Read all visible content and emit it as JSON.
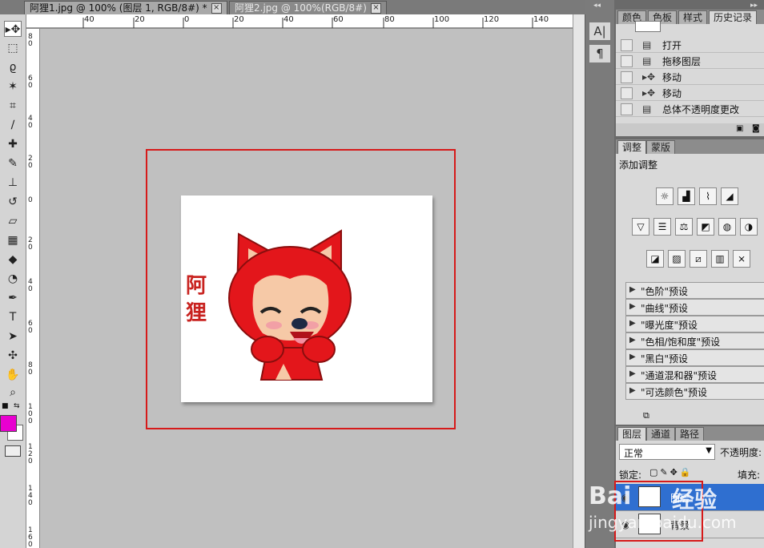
{
  "tabs": [
    {
      "label": "阿狸1.jpg @ 100% (图层 1, RGB/8#) *",
      "close": "×"
    },
    {
      "label": "阿狸2.jpg @ 100%(RGB/8#)",
      "close": "×"
    }
  ],
  "ruler": {
    "h_labels": [
      "40",
      "20",
      "0",
      "20",
      "40",
      "60",
      "80",
      "100",
      "120",
      "140"
    ],
    "v_labels": [
      "80",
      "60",
      "40",
      "20",
      "0",
      "20",
      "40",
      "60",
      "80",
      "100",
      "120",
      "140",
      "160"
    ]
  },
  "toolbar": {
    "icons": [
      "move-icon",
      "marquee-icon",
      "lasso-icon",
      "magic-wand-icon",
      "crop-icon",
      "eyedropper-icon",
      "healing-brush-icon",
      "brush-icon",
      "clone-stamp-icon",
      "history-brush-icon",
      "eraser-icon",
      "gradient-icon",
      "blur-icon",
      "dodge-icon",
      "pen-icon",
      "type-icon",
      "path-select-icon",
      "shape-icon",
      "hand-icon",
      "zoom-icon"
    ],
    "foreground_color": "#e800d0",
    "background_color": "#ffffff"
  },
  "canvas": {
    "text": "阿狸"
  },
  "mid_dock": {
    "btn1": "A|",
    "btn2": "¶"
  },
  "history_panel": {
    "tabs": [
      "颜色",
      "色板",
      "样式",
      "历史记录"
    ],
    "active_tab": "历史记录",
    "items": [
      {
        "icon": "document-icon",
        "label": "打开"
      },
      {
        "icon": "document-icon",
        "label": "拖移图层"
      },
      {
        "icon": "move-icon",
        "label": "移动"
      },
      {
        "icon": "move-icon",
        "label": "移动"
      },
      {
        "icon": "document-icon",
        "label": "总体不透明度更改"
      }
    ]
  },
  "adjust_panel": {
    "tabs": [
      "调整",
      "蒙版"
    ],
    "active_tab": "调整",
    "title": "添加调整",
    "presets": [
      "\"色阶\"预设",
      "\"曲线\"预设",
      "\"曝光度\"预设",
      "\"色相/饱和度\"预设",
      "\"黑白\"预设",
      "\"通道混和器\"预设",
      "\"可选颜色\"预设"
    ]
  },
  "layers_panel": {
    "tabs": [
      "图层",
      "通道",
      "路径"
    ],
    "active_tab": "图层",
    "blend_mode": "正常",
    "opacity_label": "不透明度:",
    "lock_label": "锁定:",
    "fill_label": "填充:",
    "layers": [
      {
        "name": "图层",
        "selected": true
      },
      {
        "name": "背景",
        "selected": false
      }
    ]
  },
  "watermark": {
    "brand": "Bai",
    "brand2": "经验",
    "url": "jingyan.baidu.com"
  },
  "colors": {
    "accent_select": "#2f6fd0",
    "highlight_red": "#d61a1a",
    "fox_red": "#e3161b"
  }
}
